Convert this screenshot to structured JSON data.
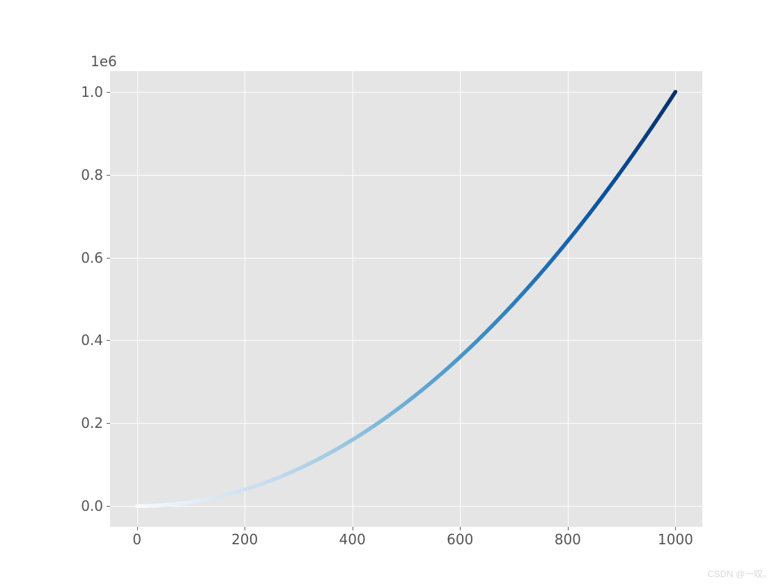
{
  "chart_data": {
    "type": "line",
    "x_range": [
      0,
      1000
    ],
    "y_function": "x^2",
    "title": "",
    "xlabel": "",
    "ylabel": "",
    "offset_text": "1e6",
    "xlim": [
      -50,
      1050
    ],
    "ylim": [
      -50000,
      1050000
    ],
    "x_ticks": [
      0,
      200,
      400,
      600,
      800,
      1000
    ],
    "y_ticks": [
      0.0,
      0.2,
      0.4,
      0.6,
      0.8,
      1.0
    ],
    "x_tick_labels": [
      "0",
      "200",
      "400",
      "600",
      "800",
      "1000"
    ],
    "y_tick_labels": [
      "0.0",
      "0.2",
      "0.4",
      "0.6",
      "0.8",
      "1.0"
    ],
    "colormap": "Blues",
    "n_points": 1001,
    "sample_points": [
      {
        "x": 0,
        "y": 0
      },
      {
        "x": 100,
        "y": 10000
      },
      {
        "x": 200,
        "y": 40000
      },
      {
        "x": 300,
        "y": 90000
      },
      {
        "x": 400,
        "y": 160000
      },
      {
        "x": 500,
        "y": 250000
      },
      {
        "x": 600,
        "y": 360000
      },
      {
        "x": 700,
        "y": 490000
      },
      {
        "x": 800,
        "y": 640000
      },
      {
        "x": 900,
        "y": 810000
      },
      {
        "x": 1000,
        "y": 1000000
      }
    ]
  },
  "watermark": "CSDN @一叹。"
}
